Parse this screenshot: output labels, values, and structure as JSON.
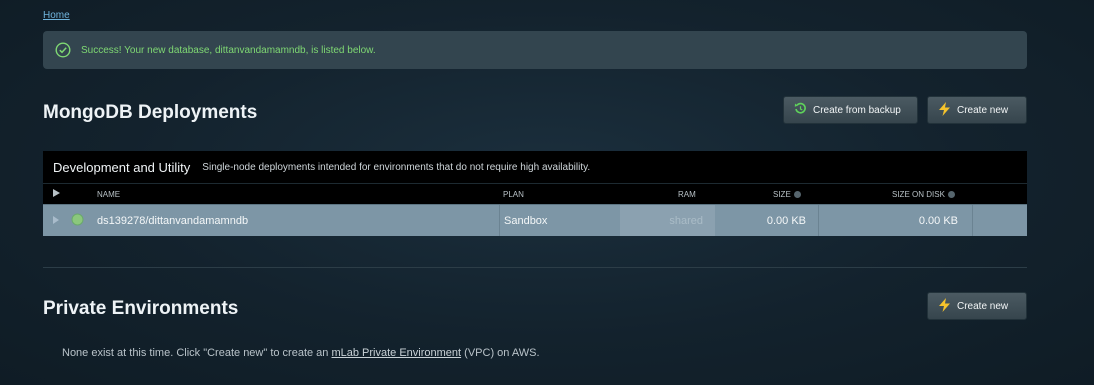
{
  "breadcrumb": {
    "home": "Home"
  },
  "alert": {
    "message": "Success! Your new database, dittanvandamamndb, is listed below."
  },
  "deployments": {
    "title": "MongoDB Deployments",
    "create_from_backup": "Create from backup",
    "create_new": "Create new"
  },
  "table": {
    "section_title": "Development and Utility",
    "section_desc": "Single-node deployments intended for environments that do not require high availability.",
    "columns": {
      "name": "NAME",
      "plan": "PLAN",
      "ram": "RAM",
      "size": "SIZE",
      "size_on_disk": "SIZE ON DISK"
    },
    "rows": [
      {
        "name": "ds139278/dittanvandamamndb",
        "plan": "Sandbox",
        "ram": "shared",
        "size": "0.00 KB",
        "size_on_disk": "0.00 KB"
      }
    ]
  },
  "private": {
    "title": "Private Environments",
    "create_new": "Create new",
    "note_before": "None exist at this time. Click \"Create new\" to create an ",
    "note_link": "mLab Private Environment",
    "note_after": " (VPC) on AWS."
  },
  "colors": {
    "success_text": "#7fd873",
    "row_bg": "#7d96a6",
    "lightning": "#f5c32c",
    "backup_icon": "#5fd35b"
  },
  "icons": [
    "check-circle-icon",
    "restore-icon",
    "lightning-icon",
    "expand-arrow-icon",
    "status-dot-icon",
    "help-icon"
  ]
}
